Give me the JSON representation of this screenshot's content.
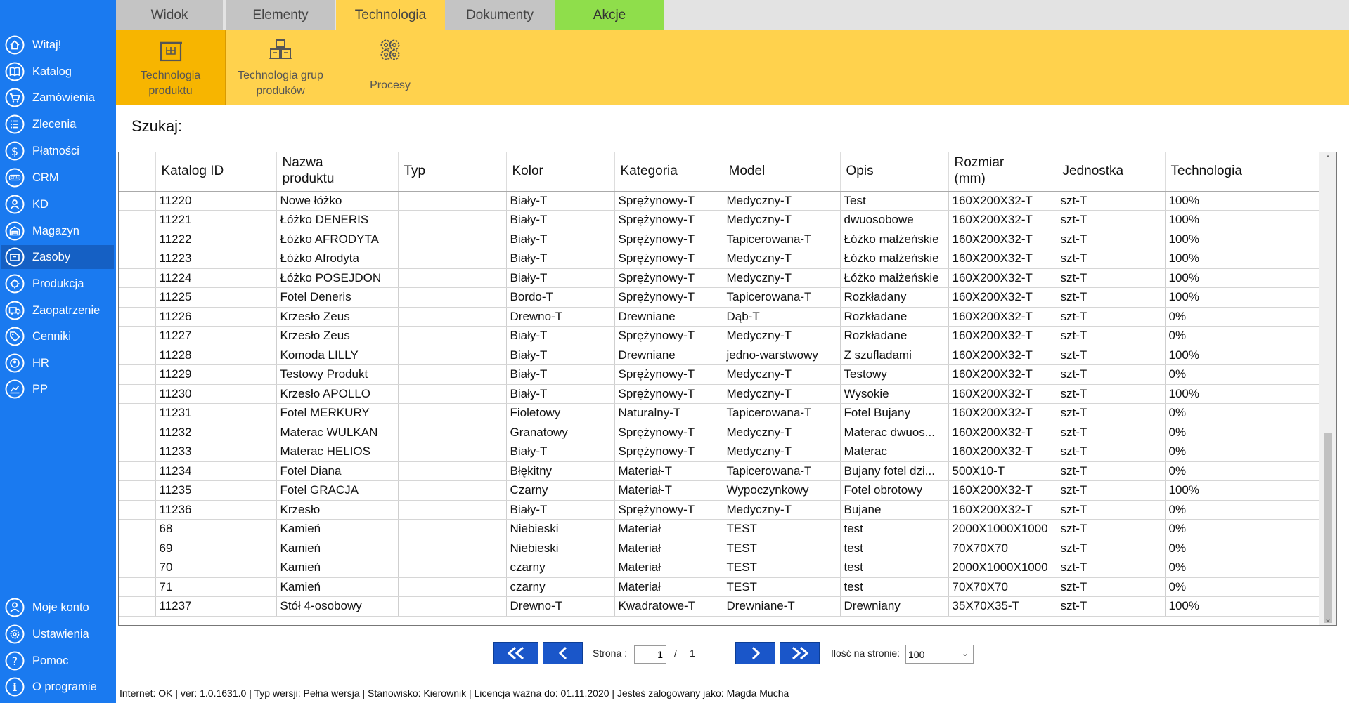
{
  "sidebar": {
    "items": [
      {
        "label": "Witaj!",
        "icon": "home-icon"
      },
      {
        "label": "Katalog",
        "icon": "book-icon"
      },
      {
        "label": "Zamówienia",
        "icon": "cart-icon"
      },
      {
        "label": "Zlecenia",
        "icon": "list-icon"
      },
      {
        "label": "Płatności",
        "icon": "dollar-icon"
      },
      {
        "label": "CRM",
        "icon": "crm-icon"
      },
      {
        "label": "KD",
        "icon": "contact-icon"
      },
      {
        "label": "Magazyn",
        "icon": "warehouse-icon"
      },
      {
        "label": "Zasoby",
        "icon": "resources-icon"
      },
      {
        "label": "Produkcja",
        "icon": "production-icon"
      },
      {
        "label": "Zaopatrzenie",
        "icon": "truck-icon"
      },
      {
        "label": "Cenniki",
        "icon": "tag-icon"
      },
      {
        "label": "HR",
        "icon": "hr-icon"
      },
      {
        "label": "PP",
        "icon": "chart-icon"
      }
    ],
    "active": "Zasoby",
    "bottom_items": [
      {
        "label": "Moje konto",
        "icon": "user-icon"
      },
      {
        "label": "Ustawienia",
        "icon": "gear-icon"
      },
      {
        "label": "Pomoc",
        "icon": "help-icon"
      },
      {
        "label": "O programie",
        "icon": "info-icon"
      }
    ]
  },
  "tabs": [
    {
      "label": "Widok"
    },
    {
      "label": "Elementy"
    },
    {
      "label": "Technologia"
    },
    {
      "label": "Dokumenty"
    },
    {
      "label": "Akcje"
    }
  ],
  "active_tab": "Technologia",
  "ribbon": {
    "buttons": [
      {
        "label": "Technologia\nproduktu",
        "icon": "product-box-icon"
      },
      {
        "label": "Technologia grup\nproduków",
        "icon": "boxes-icon"
      },
      {
        "label": "Procesy",
        "icon": "gears-icon"
      }
    ]
  },
  "search": {
    "label": "Szukaj:",
    "value": ""
  },
  "table": {
    "columns": [
      "Katalog ID",
      "Nazwa\nproduktu",
      "Typ",
      "Kolor",
      "Kategoria",
      "Model",
      "Opis",
      "Rozmiar\n(mm)",
      "Jednostka",
      "Technologia"
    ],
    "rows": [
      [
        "11220",
        "Nowe łóżko",
        "",
        "Biały-T",
        "Sprężynowy-T",
        "Medyczny-T",
        "Test",
        "160X200X32-T",
        "szt-T",
        "100%"
      ],
      [
        "11221",
        "Łóżko DENERIS",
        "",
        "Biały-T",
        "Sprężynowy-T",
        "Medyczny-T",
        "dwuosobowe",
        "160X200X32-T",
        "szt-T",
        "100%"
      ],
      [
        "11222",
        "Łóżko AFRODYTA",
        "",
        "Biały-T",
        "Sprężynowy-T",
        "Tapicerowana-T",
        "Łóżko małżeńskie",
        "160X200X32-T",
        "szt-T",
        "100%"
      ],
      [
        "11223",
        "Łóżko Afrodyta",
        "",
        "Biały-T",
        "Sprężynowy-T",
        "Medyczny-T",
        "Łóżko małżeńskie",
        "160X200X32-T",
        "szt-T",
        "100%"
      ],
      [
        "11224",
        "Łóżko POSEJDON",
        "",
        "Biały-T",
        "Sprężynowy-T",
        "Medyczny-T",
        "Łóżko małżeńskie",
        "160X200X32-T",
        "szt-T",
        "100%"
      ],
      [
        "11225",
        "Fotel Deneris",
        "",
        "Bordo-T",
        "Sprężynowy-T",
        "Tapicerowana-T",
        "Rozkładany",
        "160X200X32-T",
        "szt-T",
        "100%"
      ],
      [
        "11226",
        "Krzesło Zeus",
        "",
        "Drewno-T",
        "Drewniane",
        "Dąb-T",
        "Rozkładane",
        "160X200X32-T",
        "szt-T",
        "0%"
      ],
      [
        "11227",
        "Krzesło Zeus",
        "",
        "Biały-T",
        "Sprężynowy-T",
        "Medyczny-T",
        "Rozkładane",
        "160X200X32-T",
        "szt-T",
        "0%"
      ],
      [
        "11228",
        "Komoda LILLY",
        "",
        "Biały-T",
        "Drewniane",
        "jedno-warstwowy",
        "Z szufladami",
        "160X200X32-T",
        "szt-T",
        "100%"
      ],
      [
        "11229",
        "Testowy Produkt",
        "",
        "Biały-T",
        "Sprężynowy-T",
        "Medyczny-T",
        "Testowy",
        "160X200X32-T",
        "szt-T",
        "0%"
      ],
      [
        "11230",
        "Krzesło APOLLO",
        "",
        "Biały-T",
        "Sprężynowy-T",
        "Medyczny-T",
        "Wysokie",
        "160X200X32-T",
        "szt-T",
        "100%"
      ],
      [
        "11231",
        "Fotel MERKURY",
        "",
        "Fioletowy",
        "Naturalny-T",
        "Tapicerowana-T",
        "Fotel Bujany",
        "160X200X32-T",
        "szt-T",
        "0%"
      ],
      [
        "11232",
        "Materac WULKAN",
        "",
        "Granatowy",
        "Sprężynowy-T",
        "Medyczny-T",
        "Materac dwuos...",
        "160X200X32-T",
        "szt-T",
        "0%"
      ],
      [
        "11233",
        "Materac HELIOS",
        "",
        "Biały-T",
        "Sprężynowy-T",
        "Medyczny-T",
        "Materac",
        "160X200X32-T",
        "szt-T",
        "0%"
      ],
      [
        "11234",
        "Fotel Diana",
        "",
        "Błękitny",
        "Materiał-T",
        "Tapicerowana-T",
        "Bujany fotel dzi...",
        "500X10-T",
        "szt-T",
        "0%"
      ],
      [
        "11235",
        "Fotel GRACJA",
        "",
        "Czarny",
        "Materiał-T",
        "Wypoczynkowy",
        "Fotel obrotowy",
        "160X200X32-T",
        "szt-T",
        "100%"
      ],
      [
        "11236",
        "Krzesło",
        "",
        "Biały-T",
        "Sprężynowy-T",
        "Medyczny-T",
        "Bujane",
        "160X200X32-T",
        "szt-T",
        "0%"
      ],
      [
        "68",
        "Kamień",
        "",
        "Niebieski",
        "Materiał",
        "TEST",
        "test",
        "2000X1000X1000",
        "szt-T",
        "0%"
      ],
      [
        "69",
        "Kamień",
        "",
        "Niebieski",
        "Materiał",
        "TEST",
        "test",
        "70X70X70",
        "szt-T",
        "0%"
      ],
      [
        "70",
        "Kamień",
        "",
        "czarny",
        "Materiał",
        "TEST",
        "test",
        "2000X1000X1000",
        "szt-T",
        "0%"
      ],
      [
        "71",
        "Kamień",
        "",
        "czarny",
        "Materiał",
        "TEST",
        "test",
        "70X70X70",
        "szt-T",
        "0%"
      ],
      [
        "11237",
        "Stół 4-osobowy",
        "",
        "Drewno-T",
        "Kwadratowe-T",
        "Drewniane-T",
        "Drewniany",
        "35X70X35-T",
        "szt-T",
        "100%"
      ]
    ]
  },
  "pagination": {
    "page_label": "Strona :",
    "current_page": "1",
    "separator": "/",
    "total_pages": "1",
    "per_page_label": "Ilość na stronie:",
    "per_page_value": "100"
  },
  "statusbar": {
    "text": "Internet: OK  |   ver: 1.0.1631.0   |   Typ wersji: Pełna wersja   |   Stanowisko: Kierownik   |   Licencja ważna do: 01.11.2020   |   Jesteś zalogowany jako: Magda Mucha"
  },
  "colors": {
    "sidebar": "#1a7af0",
    "ribbon": "#ffd24d",
    "ribbon_selected": "#f7b500",
    "tab_action": "#8fde4b",
    "pager_button": "#1a56c9"
  }
}
